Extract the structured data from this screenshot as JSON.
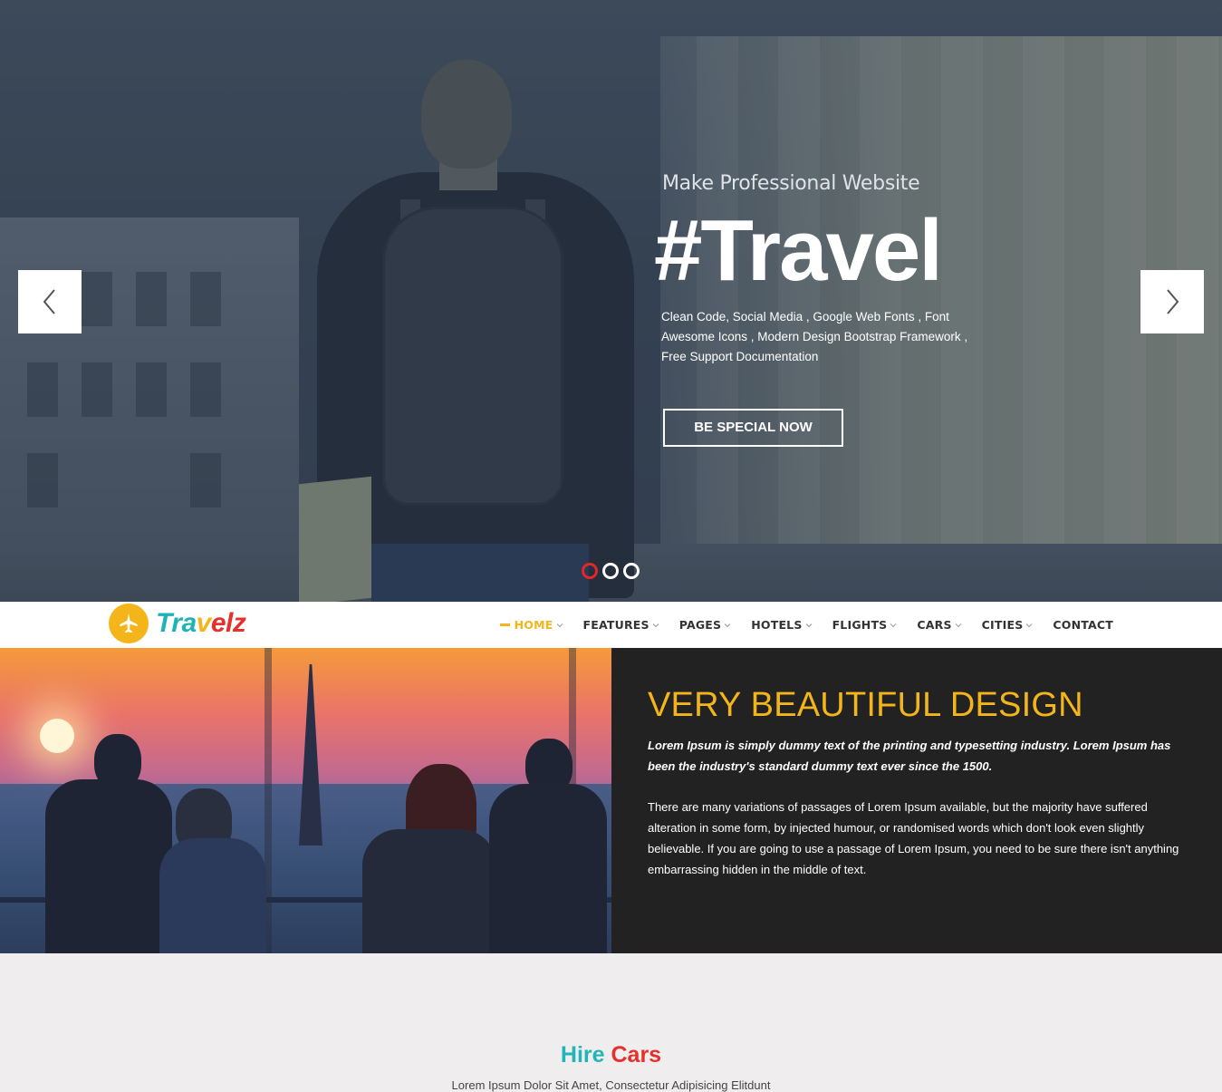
{
  "hero": {
    "subtitle": "Make Professional Website",
    "title": "#Travel",
    "description": "Clean Code, Social Media , Google Web Fonts , Font Awesome Icons , Modern Design Bootstrap Framework , Free Support Documentation",
    "cta_label": "BE SPECIAL NOW",
    "slide_count": 3,
    "active_slide": 1
  },
  "brand": {
    "logo_part1": "Tra",
    "logo_part2": "v",
    "logo_part3": "elz"
  },
  "nav": {
    "items": [
      {
        "label": "HOME",
        "dropdown": true,
        "active": true
      },
      {
        "label": "FEATURES",
        "dropdown": true
      },
      {
        "label": "PAGES",
        "dropdown": true
      },
      {
        "label": "HOTELS",
        "dropdown": true
      },
      {
        "label": "FLIGHTS",
        "dropdown": true
      },
      {
        "label": "CARS",
        "dropdown": true
      },
      {
        "label": "CITIES",
        "dropdown": true
      },
      {
        "label": "CONTACT",
        "dropdown": false
      }
    ]
  },
  "feature": {
    "title": "VERY BEAUTIFUL DESIGN",
    "lead": "Lorem Ipsum is simply dummy text of the printing and typesetting industry. Lorem Ipsum has been the industry's standard dummy text ever since the 1500.",
    "body": "There are many variations of passages of Lorem Ipsum available, but the majority have suffered alteration in some form, by injected humour, or randomised words which don't look even slightly believable. If you are going to use a passage of Lorem Ipsum, you need to be sure there isn't anything embarrassing hidden in the middle of text."
  },
  "section": {
    "title_part1": "Hire",
    "title_part2": "Cars",
    "subtitle": "Lorem Ipsum Dolor Sit Amet, Consectetur Adipisicing Elitdunt"
  },
  "colors": {
    "accent_yellow": "#f4b51a",
    "accent_teal": "#1fb3b8",
    "accent_red": "#e5302c",
    "dark_panel": "#222222"
  },
  "icons": {
    "prev": "chevron-left-icon",
    "next": "chevron-right-icon",
    "logo": "airplane-icon",
    "dropdown": "chevron-down-icon"
  }
}
